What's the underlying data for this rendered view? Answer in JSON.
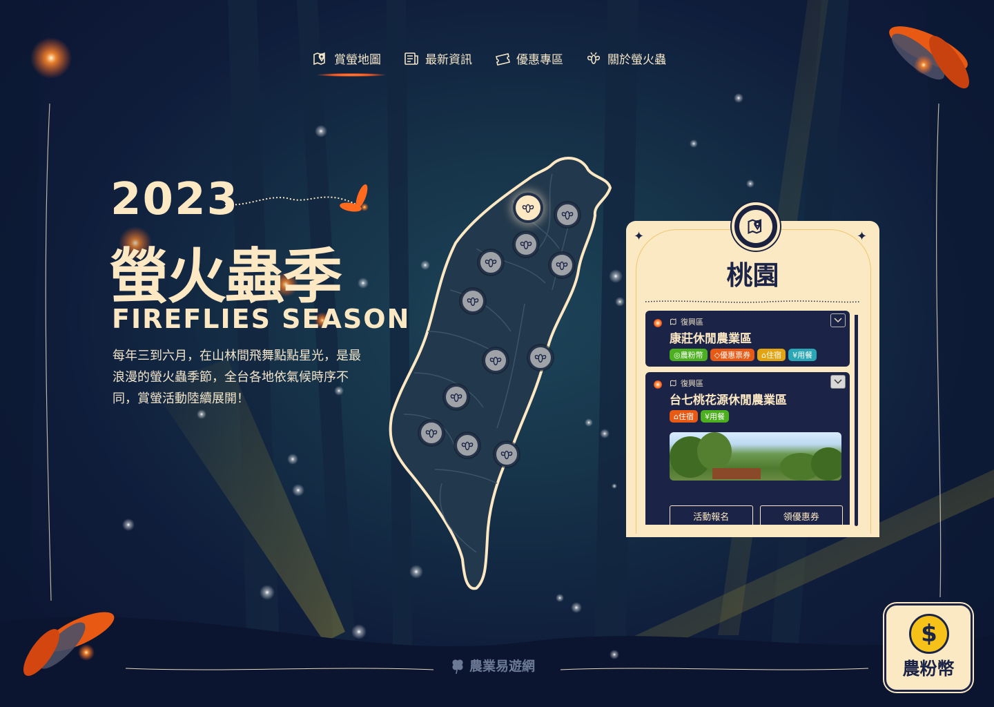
{
  "nav": {
    "items": [
      {
        "label": "賞螢地圖",
        "icon": "map-pin-icon",
        "active": true
      },
      {
        "label": "最新資訊",
        "icon": "news-icon",
        "active": false
      },
      {
        "label": "優惠專區",
        "icon": "ticket-icon",
        "active": false
      },
      {
        "label": "關於螢火蟲",
        "icon": "firefly-icon",
        "active": false
      }
    ]
  },
  "hero": {
    "year": "2023",
    "title": "螢火蟲季",
    "subtitle": "FIREFLIES SEASON",
    "description": "每年三到六月，在山林間飛舞點點星光，是最浪漫的螢火蟲季節，全台各地依氣候時序不同，賞螢活動陸續展開！"
  },
  "region_card": {
    "icon": "map-pin-icon",
    "title": "桃園",
    "farms": [
      {
        "district": "復興區",
        "name": "康莊休閒農業區",
        "tags": [
          {
            "label": "農粉幣",
            "color": "green",
            "icon": "coin-icon"
          },
          {
            "label": "優惠票券",
            "color": "orange",
            "icon": "ticket-icon"
          },
          {
            "label": "住宿",
            "color": "yellow",
            "icon": "house-icon"
          },
          {
            "label": "用餐",
            "color": "teal",
            "icon": "utensils-icon"
          }
        ],
        "expanded": false
      },
      {
        "district": "復興區",
        "name": "台七桃花源休閒農業區",
        "tags": [
          {
            "label": "住宿",
            "color": "orange",
            "icon": "house-icon"
          },
          {
            "label": "用餐",
            "color": "green",
            "icon": "utensils-icon"
          }
        ],
        "expanded": true,
        "buttons": {
          "signup": "活動報名",
          "coupon": "領優惠券"
        }
      }
    ]
  },
  "coin_button": {
    "symbol": "$",
    "label": "農粉幣"
  },
  "footer": {
    "brand": "農業易遊網"
  },
  "map": {
    "marker_count": 13,
    "active_region": "桃園"
  },
  "colors": {
    "cream": "#fbe9c4",
    "navy": "#1b2447",
    "accent_orange": "#ff5a1f",
    "coin_yellow": "#f6c21a"
  }
}
